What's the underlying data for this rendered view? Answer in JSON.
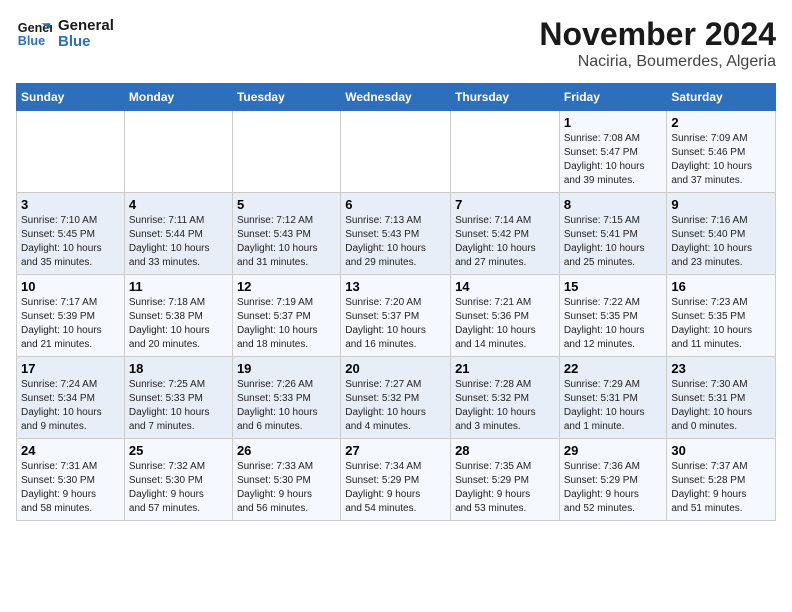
{
  "logo": {
    "line1": "General",
    "line2": "Blue"
  },
  "title": "November 2024",
  "subtitle": "Naciria, Boumerdes, Algeria",
  "headers": [
    "Sunday",
    "Monday",
    "Tuesday",
    "Wednesday",
    "Thursday",
    "Friday",
    "Saturday"
  ],
  "weeks": [
    [
      {
        "day": "",
        "info": ""
      },
      {
        "day": "",
        "info": ""
      },
      {
        "day": "",
        "info": ""
      },
      {
        "day": "",
        "info": ""
      },
      {
        "day": "",
        "info": ""
      },
      {
        "day": "1",
        "info": "Sunrise: 7:08 AM\nSunset: 5:47 PM\nDaylight: 10 hours\nand 39 minutes."
      },
      {
        "day": "2",
        "info": "Sunrise: 7:09 AM\nSunset: 5:46 PM\nDaylight: 10 hours\nand 37 minutes."
      }
    ],
    [
      {
        "day": "3",
        "info": "Sunrise: 7:10 AM\nSunset: 5:45 PM\nDaylight: 10 hours\nand 35 minutes."
      },
      {
        "day": "4",
        "info": "Sunrise: 7:11 AM\nSunset: 5:44 PM\nDaylight: 10 hours\nand 33 minutes."
      },
      {
        "day": "5",
        "info": "Sunrise: 7:12 AM\nSunset: 5:43 PM\nDaylight: 10 hours\nand 31 minutes."
      },
      {
        "day": "6",
        "info": "Sunrise: 7:13 AM\nSunset: 5:43 PM\nDaylight: 10 hours\nand 29 minutes."
      },
      {
        "day": "7",
        "info": "Sunrise: 7:14 AM\nSunset: 5:42 PM\nDaylight: 10 hours\nand 27 minutes."
      },
      {
        "day": "8",
        "info": "Sunrise: 7:15 AM\nSunset: 5:41 PM\nDaylight: 10 hours\nand 25 minutes."
      },
      {
        "day": "9",
        "info": "Sunrise: 7:16 AM\nSunset: 5:40 PM\nDaylight: 10 hours\nand 23 minutes."
      }
    ],
    [
      {
        "day": "10",
        "info": "Sunrise: 7:17 AM\nSunset: 5:39 PM\nDaylight: 10 hours\nand 21 minutes."
      },
      {
        "day": "11",
        "info": "Sunrise: 7:18 AM\nSunset: 5:38 PM\nDaylight: 10 hours\nand 20 minutes."
      },
      {
        "day": "12",
        "info": "Sunrise: 7:19 AM\nSunset: 5:37 PM\nDaylight: 10 hours\nand 18 minutes."
      },
      {
        "day": "13",
        "info": "Sunrise: 7:20 AM\nSunset: 5:37 PM\nDaylight: 10 hours\nand 16 minutes."
      },
      {
        "day": "14",
        "info": "Sunrise: 7:21 AM\nSunset: 5:36 PM\nDaylight: 10 hours\nand 14 minutes."
      },
      {
        "day": "15",
        "info": "Sunrise: 7:22 AM\nSunset: 5:35 PM\nDaylight: 10 hours\nand 12 minutes."
      },
      {
        "day": "16",
        "info": "Sunrise: 7:23 AM\nSunset: 5:35 PM\nDaylight: 10 hours\nand 11 minutes."
      }
    ],
    [
      {
        "day": "17",
        "info": "Sunrise: 7:24 AM\nSunset: 5:34 PM\nDaylight: 10 hours\nand 9 minutes."
      },
      {
        "day": "18",
        "info": "Sunrise: 7:25 AM\nSunset: 5:33 PM\nDaylight: 10 hours\nand 7 minutes."
      },
      {
        "day": "19",
        "info": "Sunrise: 7:26 AM\nSunset: 5:33 PM\nDaylight: 10 hours\nand 6 minutes."
      },
      {
        "day": "20",
        "info": "Sunrise: 7:27 AM\nSunset: 5:32 PM\nDaylight: 10 hours\nand 4 minutes."
      },
      {
        "day": "21",
        "info": "Sunrise: 7:28 AM\nSunset: 5:32 PM\nDaylight: 10 hours\nand 3 minutes."
      },
      {
        "day": "22",
        "info": "Sunrise: 7:29 AM\nSunset: 5:31 PM\nDaylight: 10 hours\nand 1 minute."
      },
      {
        "day": "23",
        "info": "Sunrise: 7:30 AM\nSunset: 5:31 PM\nDaylight: 10 hours\nand 0 minutes."
      }
    ],
    [
      {
        "day": "24",
        "info": "Sunrise: 7:31 AM\nSunset: 5:30 PM\nDaylight: 9 hours\nand 58 minutes."
      },
      {
        "day": "25",
        "info": "Sunrise: 7:32 AM\nSunset: 5:30 PM\nDaylight: 9 hours\nand 57 minutes."
      },
      {
        "day": "26",
        "info": "Sunrise: 7:33 AM\nSunset: 5:30 PM\nDaylight: 9 hours\nand 56 minutes."
      },
      {
        "day": "27",
        "info": "Sunrise: 7:34 AM\nSunset: 5:29 PM\nDaylight: 9 hours\nand 54 minutes."
      },
      {
        "day": "28",
        "info": "Sunrise: 7:35 AM\nSunset: 5:29 PM\nDaylight: 9 hours\nand 53 minutes."
      },
      {
        "day": "29",
        "info": "Sunrise: 7:36 AM\nSunset: 5:29 PM\nDaylight: 9 hours\nand 52 minutes."
      },
      {
        "day": "30",
        "info": "Sunrise: 7:37 AM\nSunset: 5:28 PM\nDaylight: 9 hours\nand 51 minutes."
      }
    ]
  ]
}
